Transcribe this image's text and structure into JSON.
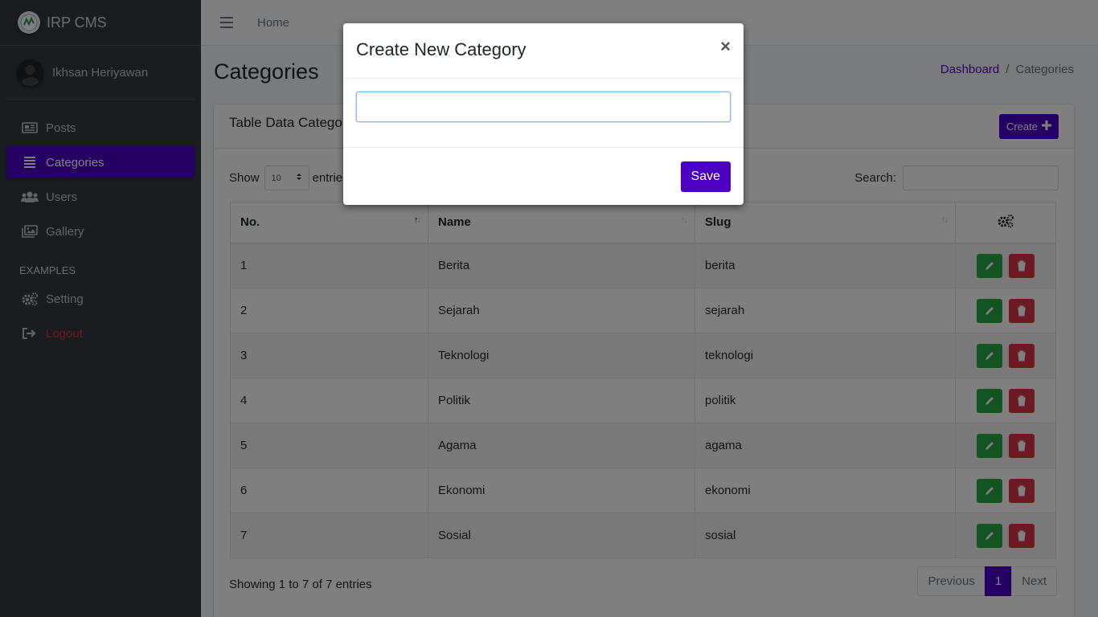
{
  "brand": {
    "name": "IRP CMS"
  },
  "user": {
    "name": "Ikhsan Heriyawan"
  },
  "sidebar": {
    "items": [
      {
        "label": "Posts",
        "icon": "newspaper-icon"
      },
      {
        "label": "Categories",
        "icon": "list-icon",
        "active": true
      },
      {
        "label": "Users",
        "icon": "users-icon"
      },
      {
        "label": "Gallery",
        "icon": "images-icon"
      }
    ],
    "header": "EXAMPLES",
    "extra": [
      {
        "label": "Setting",
        "icon": "cogs-icon"
      },
      {
        "label": "Logout",
        "icon": "sign-out-icon"
      }
    ]
  },
  "topbar": {
    "home": "Home"
  },
  "page": {
    "title": "Categories",
    "breadcrumb": {
      "link": "Dashboard",
      "sep": "/",
      "current": "Categories"
    }
  },
  "card": {
    "title": "Table Data Categori",
    "create_label": "Create",
    "show_label": "Show",
    "entries_label": "entries",
    "page_length": "10",
    "search_label": "Search:",
    "search_value": ""
  },
  "table": {
    "columns": [
      "No.",
      "Name",
      "Slug"
    ],
    "rows": [
      {
        "no": "1",
        "name": "Berita",
        "slug": "berita"
      },
      {
        "no": "2",
        "name": "Sejarah",
        "slug": "sejarah"
      },
      {
        "no": "3",
        "name": "Teknologi",
        "slug": "teknologi"
      },
      {
        "no": "4",
        "name": "Politik",
        "slug": "politik"
      },
      {
        "no": "5",
        "name": "Agama",
        "slug": "agama"
      },
      {
        "no": "6",
        "name": "Ekonomi",
        "slug": "ekonomi"
      },
      {
        "no": "7",
        "name": "Sosial",
        "slug": "sosial"
      }
    ],
    "info": "Showing 1 to 7 of 7 entries"
  },
  "pagination": {
    "previous": "Previous",
    "current": "1",
    "next": "Next"
  },
  "modal": {
    "title": "Create New Category",
    "close": "×",
    "input_value": "",
    "save_label": "Save"
  },
  "colors": {
    "primary": "#4b00c4",
    "sidebar": "#343a40",
    "edit": "#28a745",
    "delete": "#dc3545"
  }
}
